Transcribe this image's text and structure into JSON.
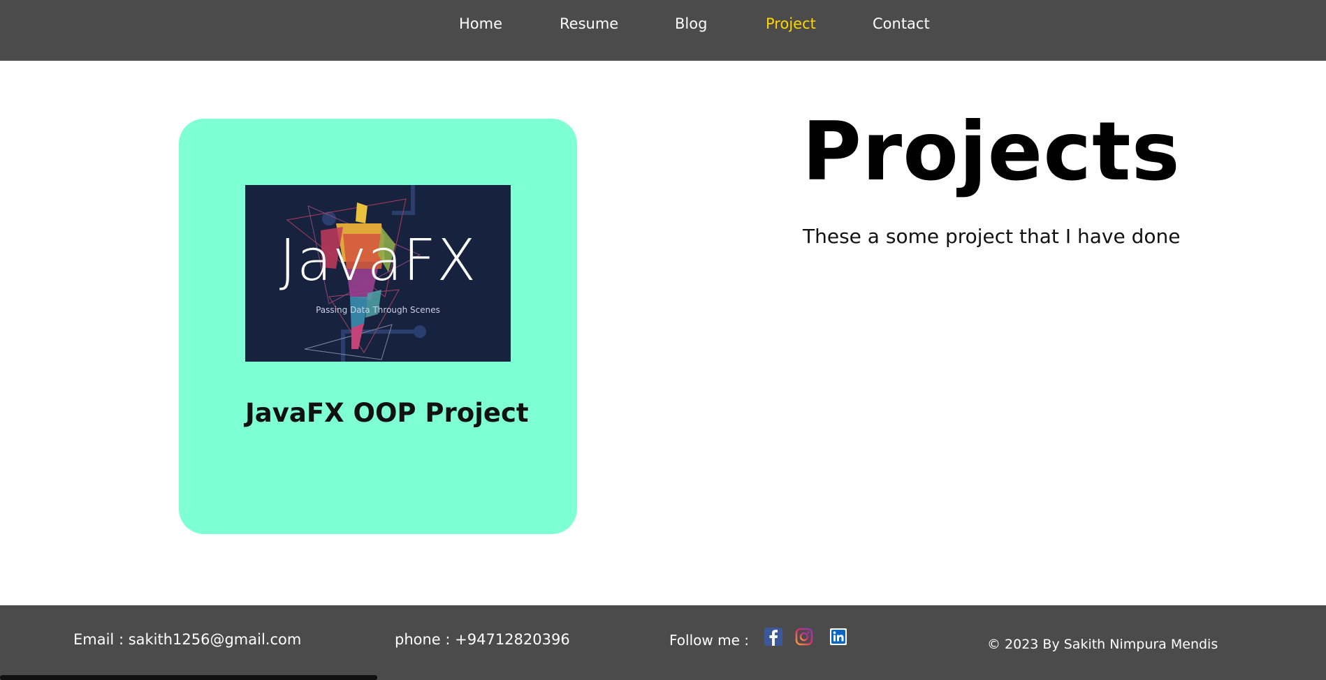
{
  "nav": {
    "items": [
      {
        "label": "Home"
      },
      {
        "label": "Resume"
      },
      {
        "label": "Blog"
      },
      {
        "label": "Project"
      },
      {
        "label": "Contact"
      }
    ],
    "active": "Project",
    "active_color": "#ffd700",
    "bar_color": "#4b4b4b"
  },
  "project_card": {
    "background": "#7fffd4",
    "image": {
      "title": "JavaFX",
      "subtitle": "Passing Data Through Scenes",
      "background": "#16223e"
    },
    "title": "JavaFX OOP Project"
  },
  "main": {
    "heading": "Projects",
    "subheading": "These a some project that I have done"
  },
  "footer": {
    "email": "Email : sakith1256@gmail.com",
    "phone": "phone : +94712820396",
    "follow_label": "Follow me :",
    "social": [
      {
        "icon": "facebook-icon"
      },
      {
        "icon": "instagram-icon"
      },
      {
        "icon": "linkedin-icon"
      }
    ],
    "copyright": "© 2023 By Sakith Nimpura Mendis"
  }
}
